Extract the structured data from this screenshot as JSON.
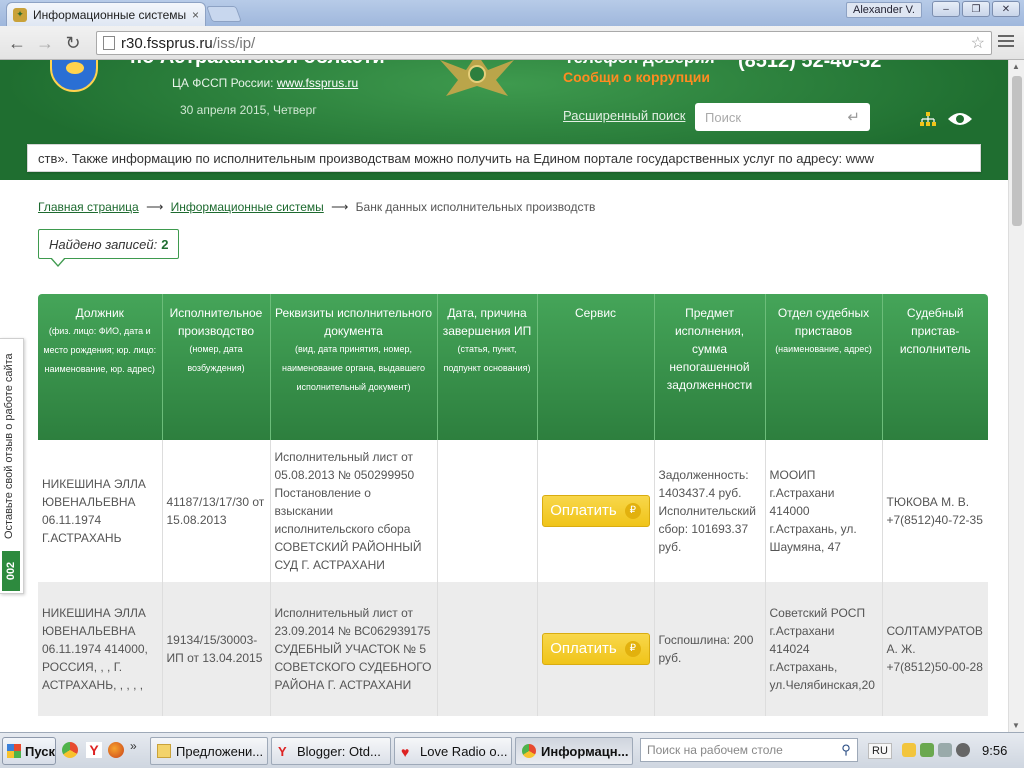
{
  "browser": {
    "tab_title": "Информационные системы",
    "user": "Alexander V.",
    "url_host": "r30.fssprus.ru",
    "url_path": "/iss/ip/"
  },
  "header": {
    "title_cut": "по Астраханской области",
    "central_label": "ЦА ФССП России:",
    "central_link": "www.fssprus.ru",
    "date": "30 апреля 2015, Четверг",
    "hotline_label": "Телефон доверия",
    "report_corruption": "Сообщи о коррупции",
    "hotline_phone": "(8512) 52-40-52",
    "advanced_search": "Расширенный поиск",
    "search_placeholder": "Поиск"
  },
  "ticker": "ств». Также информацию по исполнительным производствам можно получить на Едином портале государственных услуг по адресу: www",
  "breadcrumb": {
    "home": "Главная страница",
    "systems": "Информационные системы",
    "current": "Банк данных исполнительных производств",
    "arrow": "⟶"
  },
  "found": {
    "label": "Найдено записей:",
    "count": "2"
  },
  "table": {
    "headers": [
      {
        "main": "Должник",
        "sub": "(физ. лицо: ФИО, дата и место рождения; юр. лицо: наименование, юр. адрес)"
      },
      {
        "main": "Исполнительное производство",
        "sub": "(номер, дата возбуждения)"
      },
      {
        "main": "Реквизиты исполнительного документа",
        "sub": "(вид, дата принятия, номер, наименование органа, выдавшего исполнительный документ)"
      },
      {
        "main": "Дата, причина завершения ИП",
        "sub": "(статья, пункт, подпункт основания)"
      },
      {
        "main": "Сервис",
        "sub": ""
      },
      {
        "main": "Предмет исполнения, сумма непогашенной задолженности",
        "sub": ""
      },
      {
        "main": "Отдел судебных приставов",
        "sub": "(наименование, адрес)"
      },
      {
        "main": "Судебный пристав-исполнитель",
        "sub": ""
      }
    ],
    "rows": [
      {
        "debtor": "НИКЕШИНА ЭЛЛА ЮВЕНАЛЬЕВНА 06.11.1974 Г.АСТРАХАНЬ",
        "proceeding": "41187/13/17/30 от 15.08.2013",
        "document": "Исполнительный лист от 05.08.2013 № 050299950 Постановление о взыскании исполнительского сбора СОВЕТСКИЙ РАЙОННЫЙ СУД Г. АСТРАХАНИ",
        "completion": "",
        "service": "Оплатить",
        "subject": "Задолженность: 1403437.4 руб. Исполнительский сбор: 101693.37 руб.",
        "department": "МООИП г.Астрахани 414000 г.Астрахань, ул. Шаумяна, 47",
        "bailiff": "ТЮКОВА М. В. +7(8512)40-72-35"
      },
      {
        "debtor": "НИКЕШИНА ЭЛЛА ЮВЕНАЛЬЕВНА 06.11.1974 414000, РОССИЯ, , , Г. АСТРАХАНЬ, , , , ,",
        "proceeding": "19134/15/30003-ИП от 13.04.2015",
        "document": "Исполнительный лист от 23.09.2014 № ВС062939175 СУДЕБНЫЙ УЧАСТОК № 5 СОВЕТСКОГО СУДЕБНОГО РАЙОНА Г. АСТРАХАНИ",
        "completion": "",
        "service": "Оплатить",
        "subject": "Госпошлина: 200 руб.",
        "department": "Советский РОСП г.Астрахани 414024 г.Астрахань, ул.Челябинская,20",
        "bailiff": "СОЛТАМУРАТОВ А. Ж. +7(8512)50-00-28"
      }
    ],
    "currency_symbol": "₽"
  },
  "feedback": {
    "label": "Оставьте свой отзыв о работе сайта",
    "count": "002"
  },
  "taskbar": {
    "start": "Пуск",
    "tasks": [
      "Предложени...",
      "Blogger: Otd...",
      "Love Radio o...",
      "Информацн..."
    ],
    "search_placeholder": "Поиск на рабочем столе",
    "lang": "RU",
    "time": "9:56"
  },
  "colors": {
    "brand_green": "#2d7f3e",
    "accent_orange": "#ff8b21",
    "pay_yellow": "#f0c419"
  }
}
